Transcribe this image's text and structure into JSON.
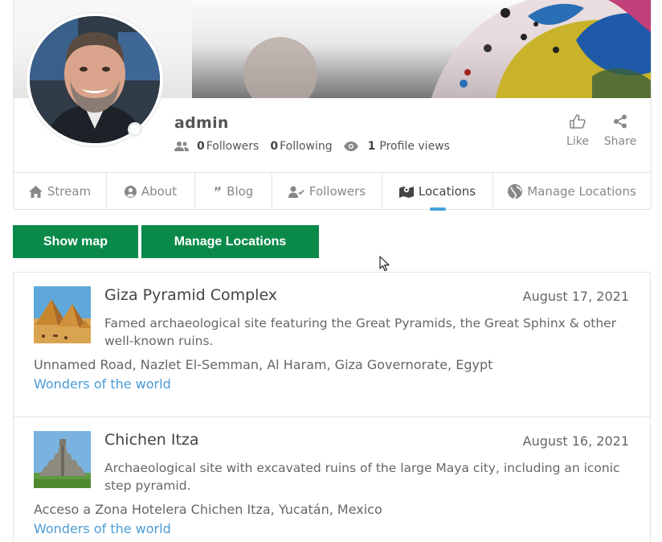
{
  "profile": {
    "username": "admin",
    "followers_count": "0",
    "followers_label": "Followers",
    "following_count": "0",
    "following_label": "Following",
    "views_count": "1",
    "views_label": "Profile views",
    "like_label": "Like",
    "share_label": "Share"
  },
  "tabs": [
    {
      "label": "Stream",
      "icon": "home-icon"
    },
    {
      "label": "About",
      "icon": "user-circle-icon"
    },
    {
      "label": "Blog",
      "icon": "quote-icon"
    },
    {
      "label": "Followers",
      "icon": "user-check-icon"
    },
    {
      "label": "Locations",
      "icon": "map-marker-icon",
      "active": true
    },
    {
      "label": "Manage Locations",
      "icon": "globe-icon"
    }
  ],
  "buttons": {
    "show_map": "Show map",
    "manage_locations": "Manage Locations"
  },
  "colors": {
    "button_green": "#0a8a4a",
    "link_blue": "#4a9bd6",
    "active_tab_indicator": "#46a3d9"
  },
  "locations": [
    {
      "title": "Giza Pyramid Complex",
      "date": "August 17, 2021",
      "description": "Famed archaeological site featuring the Great Pyramids, the Great Sphinx & other well-known ruins.",
      "address": "Unnamed Road, Nazlet El-Semman, Al Haram, Giza Governorate, Egypt",
      "category": "Wonders of the world"
    },
    {
      "title": "Chichen Itza",
      "date": "August 16, 2021",
      "description": "Archaeological site with excavated ruins of the large Maya city, including an iconic step pyramid.",
      "address": "Acceso a Zona Hotelera Chichen Itza, Yucatán, Mexico",
      "category": "Wonders of the world"
    }
  ]
}
